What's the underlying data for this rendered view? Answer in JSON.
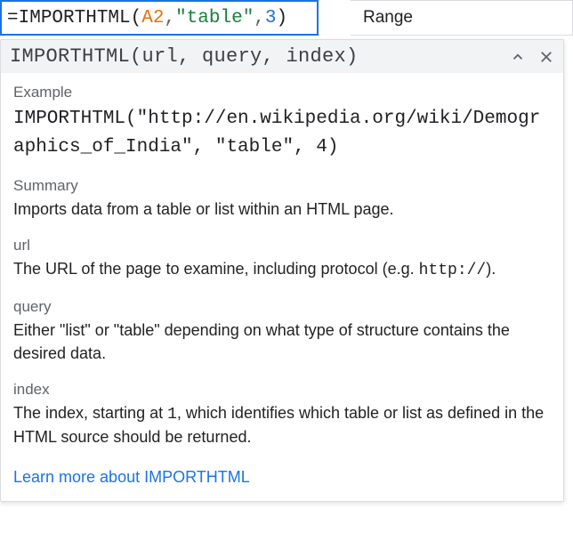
{
  "formula": {
    "prefix_eq": "=",
    "func": "IMPORTHTML",
    "open": "(",
    "arg1": "A2",
    "comma1": ",",
    "arg2": "\"table\"",
    "comma2": ",",
    "arg3": "3",
    "close": ")"
  },
  "adjacent_label": "Range",
  "tooltip": {
    "signature": "IMPORTHTML(url, query, index)",
    "example_label": "Example",
    "example_code": "IMPORTHTML(\"http://en.wikipedia.org/wiki/Demographics_of_India\", \"table\", 4)",
    "summary_label": "Summary",
    "summary_text": "Imports data from a table or list within an HTML page.",
    "url_label": "url",
    "url_text_1": "The URL of the page to examine, including protocol (e.g. ",
    "url_code": "http://",
    "url_text_2": ").",
    "query_label": "query",
    "query_text": "Either \"list\" or \"table\" depending on what type of structure contains the desired data.",
    "index_label": "index",
    "index_text_1": "The index, starting at ",
    "index_code": "1",
    "index_text_2": ", which identifies which table or list as defined in the HTML source should be returned.",
    "learn_more": "Learn more about IMPORTHTML"
  }
}
